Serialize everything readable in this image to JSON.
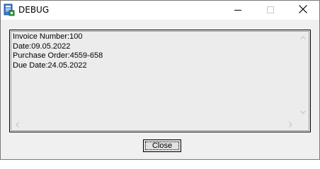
{
  "window": {
    "title": "DEBUG",
    "icon": "app-document-icon",
    "controls": [
      "minimize-icon",
      "maximize-icon",
      "close-icon"
    ]
  },
  "memo": {
    "lines": [
      "Invoice Number:100",
      "Date:09.05.2022",
      "Purchase Order:4559-658",
      "Due Date:24.05.2022"
    ]
  },
  "footer": {
    "close_label": "Close"
  }
}
